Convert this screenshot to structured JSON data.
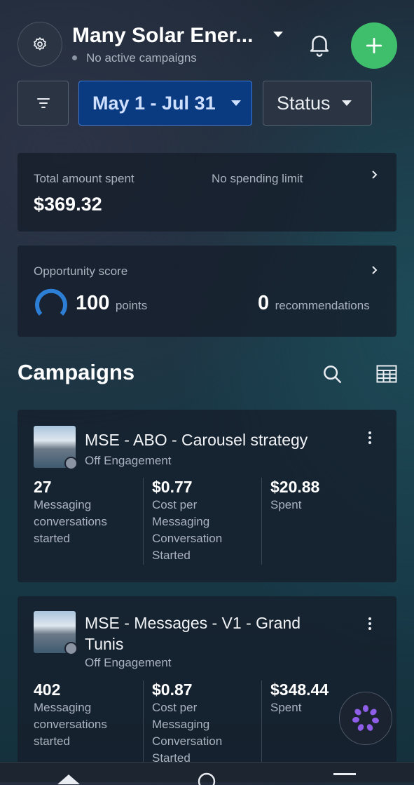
{
  "header": {
    "account_name": "Many Solar Ener...",
    "account_status": "No active campaigns"
  },
  "filters": {
    "date_range": "May 1 - Jul 31",
    "status_label": "Status"
  },
  "spend_card": {
    "label": "Total amount spent",
    "amount": "$369.32",
    "limit_text": "No spending limit"
  },
  "opportunity_card": {
    "label": "Opportunity score",
    "score": "100",
    "score_unit": "points",
    "recommendations_count": "0",
    "recommendations_label": "recommendations",
    "score_fraction": 1.0
  },
  "campaigns": {
    "title": "Campaigns",
    "items": [
      {
        "name": "MSE - ABO - Carousel strategy",
        "status": "Off",
        "objective": "Engagement",
        "metrics": [
          {
            "value": "27",
            "label": "Messaging conversations started"
          },
          {
            "value": "$0.77",
            "label": "Cost per Messaging Conversation Started"
          },
          {
            "value": "$20.88",
            "label": "Spent"
          }
        ]
      },
      {
        "name": "MSE - Messages - V1 - Grand Tunis",
        "status": "Off",
        "objective": "Engagement",
        "metrics": [
          {
            "value": "402",
            "label": "Messaging conversations started"
          },
          {
            "value": "$0.87",
            "label": "Cost per Messaging Conversation Started"
          },
          {
            "value": "$348.44",
            "label": "Spent"
          }
        ]
      }
    ]
  },
  "colors": {
    "accent_green": "#3fbf6c",
    "date_button_bg": "#0a3a80",
    "score_ring": "#2d7fd6"
  },
  "icons": [
    "gear-icon",
    "bell-icon",
    "plus-icon",
    "filter-icon",
    "search-icon",
    "table-icon",
    "chevron-right-icon",
    "kebab-menu-icon",
    "meta-ai-icon"
  ]
}
